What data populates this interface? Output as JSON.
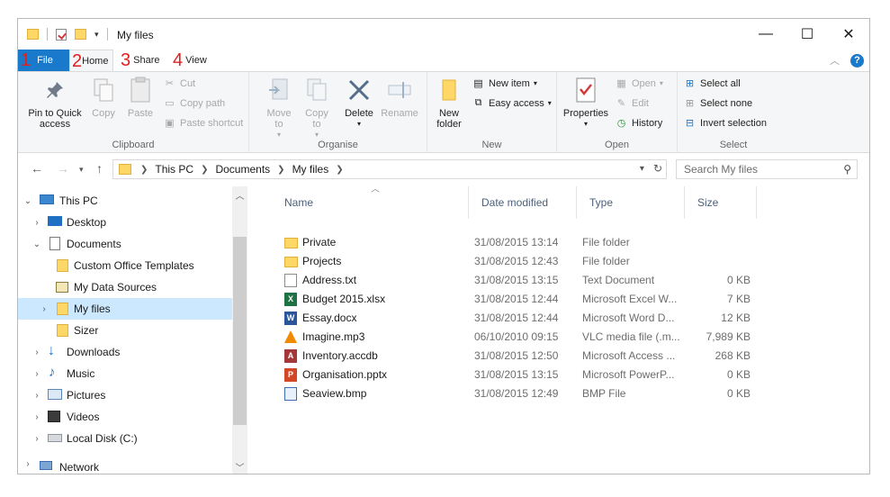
{
  "title": "My files",
  "tabs": [
    {
      "num": "1",
      "label": "File"
    },
    {
      "num": "2",
      "label": "Home"
    },
    {
      "num": "3",
      "label": "Share"
    },
    {
      "num": "4",
      "label": "View"
    }
  ],
  "ribbon": {
    "clipboard": {
      "label": "Clipboard",
      "pin": "Pin to Quick access",
      "copy": "Copy",
      "paste": "Paste",
      "cut": "Cut",
      "copy_path": "Copy path",
      "paste_shortcut": "Paste shortcut"
    },
    "organise": {
      "label": "Organise",
      "move_to": "Move to",
      "copy_to": "Copy to",
      "delete": "Delete",
      "rename": "Rename"
    },
    "new": {
      "label": "New",
      "new_folder": "New folder",
      "new_item": "New item",
      "easy_access": "Easy access"
    },
    "open": {
      "label": "Open",
      "properties": "Properties",
      "open": "Open",
      "edit": "Edit",
      "history": "History"
    },
    "select": {
      "label": "Select",
      "select_all": "Select all",
      "select_none": "Select none",
      "invert": "Invert selection"
    }
  },
  "address": {
    "crumbs": [
      "This PC",
      "Documents",
      "My files"
    ],
    "search_placeholder": "Search My files"
  },
  "nav": [
    {
      "label": "This PC",
      "icon": "pc-icon"
    },
    {
      "label": "Desktop",
      "icon": "desktop-icon"
    },
    {
      "label": "Documents",
      "icon": "documents-icon"
    },
    {
      "label": "Custom Office Templates",
      "icon": "folder-icon"
    },
    {
      "label": "My Data Sources",
      "icon": "data-sources-icon"
    },
    {
      "label": "My files",
      "icon": "folder-icon"
    },
    {
      "label": "Sizer",
      "icon": "folder-icon"
    },
    {
      "label": "Downloads",
      "icon": "downloads-icon"
    },
    {
      "label": "Music",
      "icon": "music-icon"
    },
    {
      "label": "Pictures",
      "icon": "pictures-icon"
    },
    {
      "label": "Videos",
      "icon": "videos-icon"
    },
    {
      "label": "Local Disk (C:)",
      "icon": "disk-icon"
    },
    {
      "label": "Network",
      "icon": "network-icon"
    }
  ],
  "columns": [
    "Name",
    "Date modified",
    "Type",
    "Size"
  ],
  "files": [
    {
      "name": "Private",
      "date": "31/08/2015 13:14",
      "type": "File folder",
      "size": "",
      "icon": "folder"
    },
    {
      "name": "Projects",
      "date": "31/08/2015 12:43",
      "type": "File folder",
      "size": "",
      "icon": "folder"
    },
    {
      "name": "Address.txt",
      "date": "31/08/2015 13:15",
      "type": "Text Document",
      "size": "0 KB",
      "icon": "doc"
    },
    {
      "name": "Budget 2015.xlsx",
      "date": "31/08/2015 12:44",
      "type": "Microsoft Excel W...",
      "size": "7 KB",
      "icon": "xl"
    },
    {
      "name": "Essay.docx",
      "date": "31/08/2015 12:44",
      "type": "Microsoft Word D...",
      "size": "12 KB",
      "icon": "wd"
    },
    {
      "name": "Imagine.mp3",
      "date": "06/10/2010 09:15",
      "type": "VLC media file (.m...",
      "size": "7,989 KB",
      "icon": "vlc"
    },
    {
      "name": "Inventory.accdb",
      "date": "31/08/2015 12:50",
      "type": "Microsoft Access ...",
      "size": "268 KB",
      "icon": "ac"
    },
    {
      "name": "Organisation.pptx",
      "date": "31/08/2015 13:15",
      "type": "Microsoft PowerP...",
      "size": "0 KB",
      "icon": "pp"
    },
    {
      "name": "Seaview.bmp",
      "date": "31/08/2015 12:49",
      "type": "BMP File",
      "size": "0 KB",
      "icon": "bm"
    }
  ]
}
